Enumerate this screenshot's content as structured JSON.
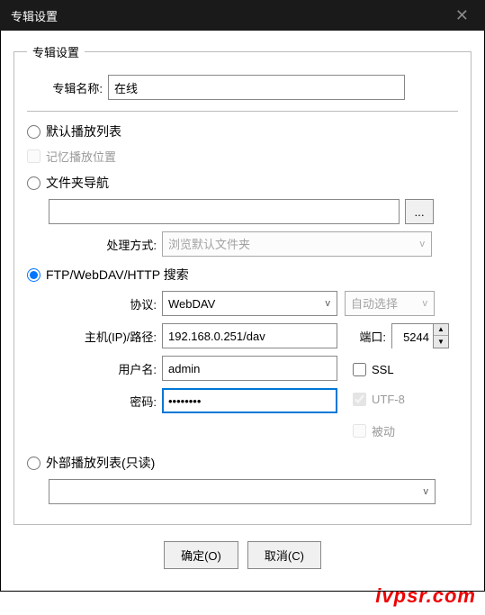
{
  "titlebar": {
    "title": "专辑设置"
  },
  "fieldset": {
    "legend": "专辑设置"
  },
  "albumName": {
    "label": "专辑名称:",
    "value": "在线"
  },
  "playlist": {
    "default_label": "默认播放列表",
    "remember_label": "记忆播放位置"
  },
  "folder": {
    "nav_label": "文件夹导航",
    "path_value": "",
    "browse_label": "...",
    "method_label": "处理方式:",
    "method_value": "浏览默认文件夹"
  },
  "ftp": {
    "section_label": "FTP/WebDAV/HTTP 搜索",
    "protocol_label": "协议:",
    "protocol_value": "WebDAV",
    "auto_select": "自动选择",
    "host_label": "主机(IP)/路径:",
    "host_value": "192.168.0.251/dav",
    "port_label": "端口:",
    "port_value": "5244",
    "user_label": "用户名:",
    "user_value": "admin",
    "pass_label": "密码:",
    "pass_value": "••••••••",
    "ssl_label": "SSL",
    "utf8_label": "UTF-8",
    "passive_label": "被动"
  },
  "external": {
    "label": "外部播放列表(只读)",
    "value": ""
  },
  "buttons": {
    "ok": "确定(O)",
    "cancel": "取消(C)"
  },
  "watermark": "ivpsr.com"
}
